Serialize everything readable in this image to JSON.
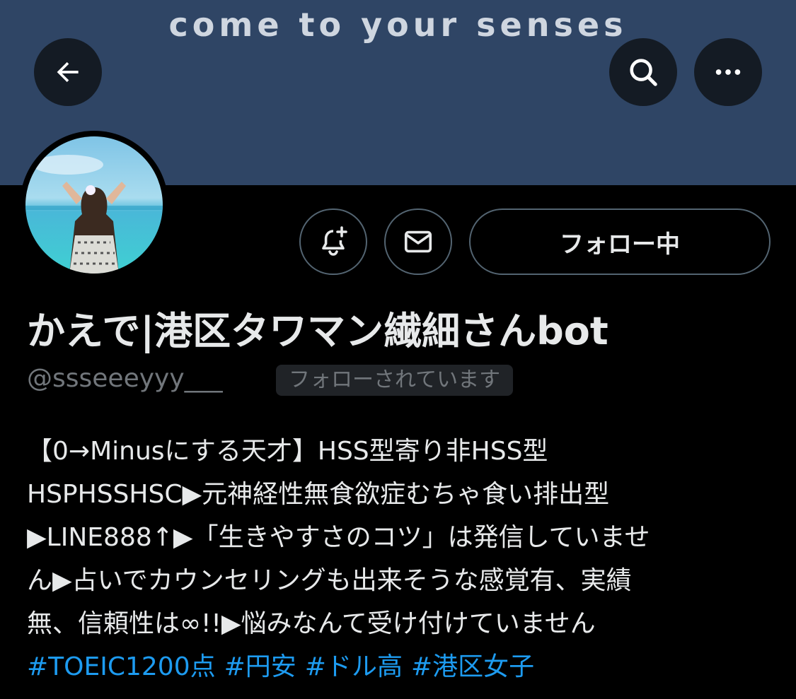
{
  "banner": {
    "text": "come to your senses",
    "background": "#2f4565"
  },
  "header_buttons": {
    "back_icon": "arrow-left-icon",
    "search_icon": "search-icon",
    "more_icon": "more-horizontal-icon"
  },
  "profile": {
    "display_name": "かえで|港区タワマン繊細さんbot",
    "handle": "@ssseeeyyy___",
    "follows_you_label": "フォローされています",
    "bio_lines": [
      "【0→Minusにする天才】HSS型寄り非HSS型",
      "HSPHSSHSC▶元神経性無食欲症むちゃ食い排出型",
      "▶LINE888↑▶「生きやすさのコツ」は発信していませ",
      "ん▶占いでカウンセリングも出来そうな感覚有、実績",
      "無、信頼性は∞!!▶悩みなんて受け付けていません"
    ],
    "hashtags": [
      "#TOEIC1200点",
      "#円安",
      "#ドル高",
      "#港区女子"
    ]
  },
  "actions": {
    "notify_icon": "bell-plus-icon",
    "message_icon": "mail-icon",
    "following_label": "フォロー中"
  },
  "colors": {
    "background": "#000000",
    "text": "#e7e9ea",
    "muted": "#71767b",
    "link": "#1d9bf0",
    "border": "#536471"
  }
}
